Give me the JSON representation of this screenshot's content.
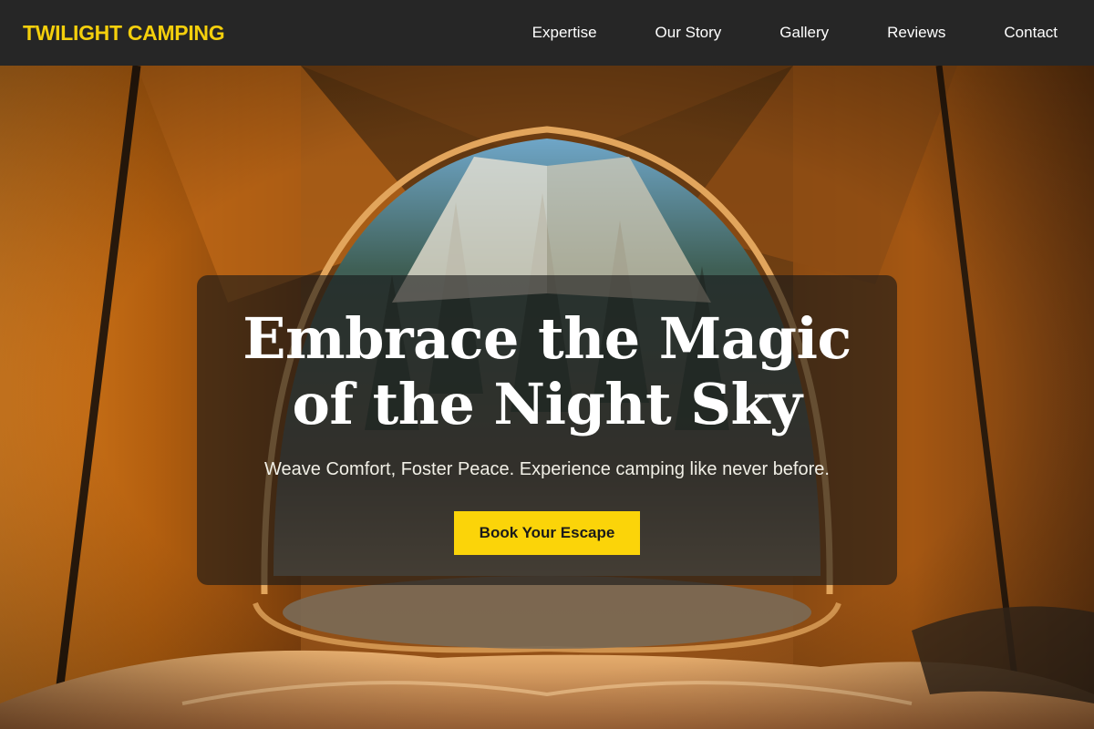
{
  "header": {
    "logo": "TWILIGHT CAMPING",
    "nav": [
      {
        "label": "Expertise"
      },
      {
        "label": "Our Story"
      },
      {
        "label": "Gallery"
      },
      {
        "label": "Reviews"
      },
      {
        "label": "Contact"
      }
    ]
  },
  "hero": {
    "title": "Embrace the Magic of the Night Sky",
    "subtitle": "Weave Comfort, Foster Peace. Experience camping like never before.",
    "cta_label": "Book Your Escape"
  },
  "colors": {
    "header_bg": "#262626",
    "brand_yellow": "#f4cf0c",
    "button_yellow": "#fbd409",
    "tent_orange": "#c86e1c"
  }
}
